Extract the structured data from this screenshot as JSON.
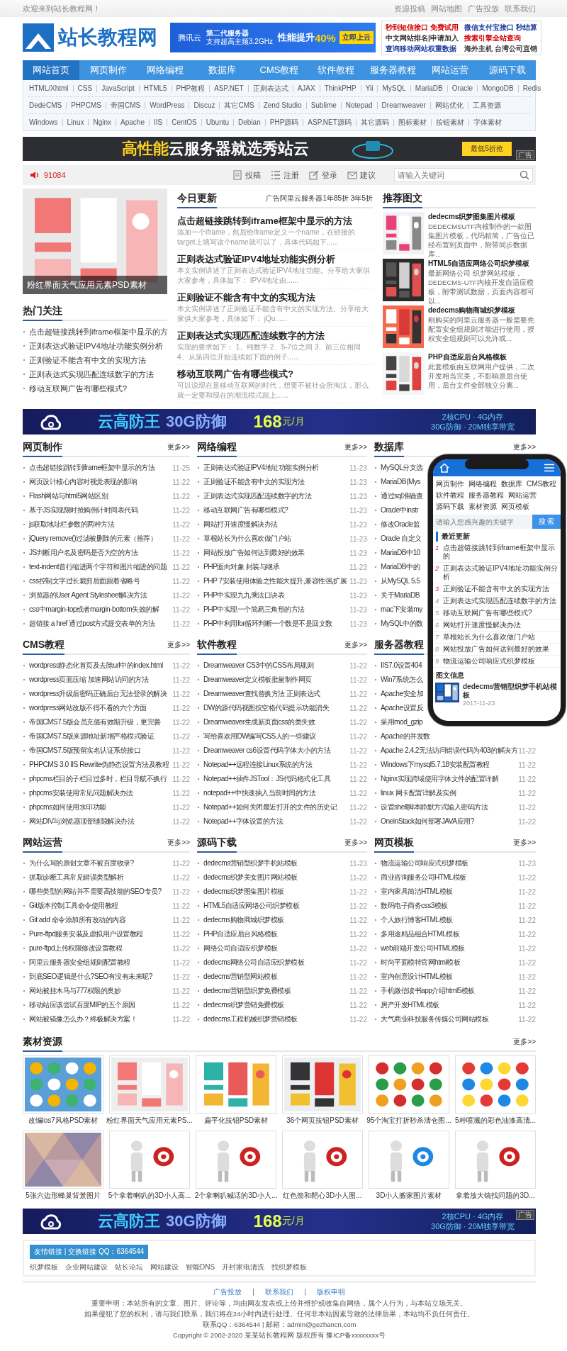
{
  "top_bar": {
    "welcome": "欢迎来到站长教程网！",
    "links": [
      "资源投稿",
      "网站地图",
      "广告投放",
      "联系我们"
    ]
  },
  "header": {
    "logo": "站长教程网",
    "banner": {
      "brand": "腾讯云",
      "line1": "第二代服务器",
      "line2": "支持超高主频3.2GHz",
      "headline": "性能提升",
      "highlight": "40%",
      "button": "立即上云"
    },
    "ad_links": [
      {
        "text": "秒到短信接口 免费试用",
        "color": "#d40000"
      },
      {
        "text": "微信支付宝接口 秒结算",
        "color": "#1a3a9c"
      },
      {
        "text": "中文网站排名|申请加入",
        "color": "#333333"
      },
      {
        "text": "搜索引擎全站查询",
        "color": "#d40000"
      },
      {
        "text": "查询移动网站权重数据",
        "color": "#1a3a9c"
      },
      {
        "text": "海外主机 台湾公司直销",
        "color": "#333333"
      }
    ]
  },
  "nav": [
    {
      "label": "网站首页",
      "selected": true
    },
    {
      "label": "网页制作",
      "selected": false
    },
    {
      "label": "网络编程",
      "selected": false
    },
    {
      "label": "数据库",
      "selected": false
    },
    {
      "label": "CMS教程",
      "selected": false
    },
    {
      "label": "软件教程",
      "selected": false
    },
    {
      "label": "服务器教程",
      "selected": false
    },
    {
      "label": "网站运营",
      "selected": false
    },
    {
      "label": "源码下载",
      "selected": false
    }
  ],
  "subnav": [
    [
      "HTML/Xhtml",
      "CSS",
      "JavaScript",
      "HTML5",
      "PHP教程",
      "ASP.NET",
      "正则表达式",
      "AJAX",
      "ThinkPHP",
      "Yii",
      "MySQL",
      "MariaDB",
      "Oracle",
      "MongoDB",
      "Redis"
    ],
    [
      "DedeCMS",
      "PHPCMS",
      "帝国CMS",
      "WordPress",
      "Discuz",
      "其它CMS",
      "Zend Studio",
      "Sublime",
      "Notepad",
      "Dreamweaver",
      "网站优化",
      "工具资源"
    ],
    [
      "Windows",
      "Linux",
      "Nginx",
      "Apache",
      "IIS",
      "CentOS",
      "Ubuntu",
      "Debian",
      "PHP源码",
      "ASP.NET源码",
      "其它源码",
      "图标素材",
      "按钮素材",
      "字体素材"
    ]
  ],
  "banner_ad": {
    "highlight": "高性能",
    "text": "云服务器就选秀站云",
    "button": "最低5折抢",
    "tag": "广告"
  },
  "toolbar": {
    "count": "91084",
    "actions": [
      "投稿",
      "注册",
      "登录",
      "建议"
    ],
    "search": {
      "placeholder": "请输入关键词"
    }
  },
  "featured": {
    "kind": "picture",
    "caption": "粉红界面天气应用元素PSD素材"
  },
  "hot": {
    "title": "热门关注",
    "items": [
      "点击超链接跳转到iframe框架中显示的方",
      "正则表达式验证IPV4地址功能实例分析",
      "正则验证不能含有中文的实现方法",
      "正则表达式实现匹配连续数字的方法",
      "移动互联网广告有哪些模式?"
    ]
  },
  "today": {
    "title": "今日更新",
    "ad": "广告阿里云服务器1年85折 3年5折",
    "articles": [
      {
        "title": "点击超链接跳转到iframe框架中显示的方法",
        "summary": "添加一个iframe，然后给iframe定义一个name，在链接的target上填写这个name就可以了，具体代码如下......"
      },
      {
        "title": "正则表达式验证IPV4地址功能实例分析",
        "summary": "本文实例讲述了正则表达式验证IPV4地址功能。分享给大家供大家参考，具体如下： IPV4地址由......"
      },
      {
        "title": "正则验证不能含有中文的实现方法",
        "summary": "本文实例讲述了正则验证不能含有中文的实现方法。分享给大家供大家参考，具体如下： jQu......"
      },
      {
        "title": "正则表达式实现匹配连续数字的方法",
        "summary": "实现的要求如下： 1、纯数字 2、5-7位之间 3、前三位相同 4、从第四位开始连续如下面的例子......"
      },
      {
        "title": "移动互联网广告有哪些模式?",
        "summary": "可以说现在是移动互联网的时代，想要不被社会所淘汰，那么就一定要和现在的潮流模式跟上......"
      }
    ]
  },
  "recommend": {
    "title": "推荐图文",
    "items": [
      {
        "title": "dedecms织梦图集图片模板",
        "desc": "DEDECMSUTF内核制作的一款图集图片模板，代码精简，广告位已经布置到页面中，附带同步数据库..."
      },
      {
        "title": "HTML5自适应网络公司织梦模板",
        "desc": "最新网络公司 织梦网站模板，DEDECMS-UTF内核开发自适应模板，附带测试数据，页面内容都可以..."
      },
      {
        "title": "dedecms购物商城织梦模板",
        "desc": "刚购买的阿里云服务器一般需要先配置安全组规则才能进行使用，授权安全组规则可以允许或..."
      },
      {
        "title": "PHP自适应后台风格模板",
        "desc": "此套模板由互联网用户提供，二次开发相当完美，不影响原后台使用，后台文件全部独立分离..."
      }
    ]
  },
  "ad_banner_top": {
    "title": "云高防王",
    "highlight": "30G防御",
    "price": "168",
    "unit": "元/月",
    "spec1": "2核CPU · 4G内存",
    "spec2": "30G防御 · 20M独享带宽"
  },
  "sections": [
    {
      "title": "网页制作",
      "more": "更多>>",
      "items": [
        {
          "title": "点击超链接跳转到iframe框架中显示的方法",
          "date": "11-25"
        },
        {
          "title": "网页设计核心内容对视觉表现的影响",
          "date": "11-22"
        },
        {
          "title": "Flash网站与html5网站区别",
          "date": "11-22"
        },
        {
          "title": "基于JS实现限时抢购倒计时间表代码",
          "date": "11-22"
        },
        {
          "title": "js获取地址栏参数的两种方法",
          "date": "11-22"
        },
        {
          "title": "jQuery remove()过滤被删除的元素（推荐）",
          "date": "11-22"
        },
        {
          "title": "JS判断用户名及密码是否为空的方法",
          "date": "11-22"
        },
        {
          "title": "text-indent首行缩进两个字符和图片缩进的问题",
          "date": "11-22"
        },
        {
          "title": "css控制文字过长裁剪后面跟着省略号",
          "date": "11-22"
        },
        {
          "title": "浏览器的User Agent Stylesheet解决方法",
          "date": "11-22"
        },
        {
          "title": "css中margin-top或者margin-bottom失效的解",
          "date": "11-22"
        },
        {
          "title": "超链接 a href 通过post方式提交表单的方法",
          "date": "11-22"
        }
      ]
    },
    {
      "title": "网络编程",
      "more": "更多>>",
      "items": [
        {
          "title": "正则表达式验证IPV4地址功能实例分析",
          "date": "11-23"
        },
        {
          "title": "正则验证不能含有中文的实现方法",
          "date": "11-23"
        },
        {
          "title": "正则表达式实现匹配连续数字的方法",
          "date": "11-23"
        },
        {
          "title": "移动互联网广告有哪些模式?",
          "date": "11-23"
        },
        {
          "title": "网站打开速度慢解决办法",
          "date": "11-23"
        },
        {
          "title": "草根站长为什么喜欢做门户站",
          "date": "11-23"
        },
        {
          "title": "网站投放广告如何达到最好的效果",
          "date": "11-23"
        },
        {
          "title": "PHP面向对象 封装与继承",
          "date": "11-23"
        },
        {
          "title": "PHP 7安装使用体验之性能大提升,兼容性强,扩展",
          "date": "11-23"
        },
        {
          "title": "PHP中实现九九乘法口诀表",
          "date": "11-23"
        },
        {
          "title": "PHP中实现一个简易三角形的方法",
          "date": "11-23"
        },
        {
          "title": "PHP中利用for循环判断一个数是不是回文数",
          "date": "11-23"
        }
      ]
    },
    {
      "title": "数据库",
      "more": "更多>>",
      "items": [
        {
          "title": "MySQL分支选"
        },
        {
          "title": "MariaDB(Mys"
        },
        {
          "title": "通过sql准确查"
        },
        {
          "title": "Oracle中instr"
        },
        {
          "title": "修改Oracle监"
        },
        {
          "title": "Oracle 自定义"
        },
        {
          "title": "MariaDB中10"
        },
        {
          "title": "MariaDB中的"
        },
        {
          "title": "从MySQL 5.5"
        },
        {
          "title": "关于MariaDB"
        },
        {
          "title": "mac下安装my"
        },
        {
          "title": "MySQL中的数"
        }
      ]
    },
    {
      "title": "CMS教程",
      "more": "更多>>",
      "items": [
        {
          "title": "wordpress静态化首页及去除url中的index.html",
          "date": "11-22"
        },
        {
          "title": "wordpress页面压缩 加速网站访问的方法",
          "date": "11-22"
        },
        {
          "title": "wordpress升级后密码正确后台无法登录的解决",
          "date": "11-22"
        },
        {
          "title": "wordpress网站改版不得不看的六个方面",
          "date": "11-22"
        },
        {
          "title": "帝国CMS7.5版会员充值有效期升级，更完善",
          "date": "11-22"
        },
        {
          "title": "帝国CMS7.5版来源地址新增严格模式验证",
          "date": "11-22"
        },
        {
          "title": "帝国CMS7.5版预留实名认证系统接口",
          "date": "11-22"
        },
        {
          "title": "PHPCMS 3.0 IIS Rewrite伪静态设置方法及教程",
          "date": "11-22"
        },
        {
          "title": "phpcms栏目的子栏目过多时，栏目导航不换行",
          "date": "11-22"
        },
        {
          "title": "phpcms安装使用常见问题解决办法",
          "date": "11-22"
        },
        {
          "title": "phpcms如何使用水印功能",
          "date": "11-22"
        },
        {
          "title": "网站DIV与浏览器顶部缝隙解决办法",
          "date": "11-22"
        }
      ]
    },
    {
      "title": "软件教程",
      "more": "更多>>",
      "items": [
        {
          "title": "Dreamweaver CS3中的CSS布局规则",
          "date": "11-22"
        },
        {
          "title": "Dreamweaver定义模板批量制作网页",
          "date": "11-22"
        },
        {
          "title": "Dreamweaver查找替换方法 正则表达式",
          "date": "11-22"
        },
        {
          "title": "DW的源代码视图按空格代码提示功能消失",
          "date": "11-22"
        },
        {
          "title": "Dreamweaver生成新页面css的类失效",
          "date": "11-22"
        },
        {
          "title": "写给喜欢用DW编写CSS人的一些建议",
          "date": "11-22"
        },
        {
          "title": "Dreamweaver cs6设置代码字体大小的方法",
          "date": "11-22"
        },
        {
          "title": "Notepad++远程连接Linux系统的方法",
          "date": "11-22"
        },
        {
          "title": "Notepad++插件JSTool：JS代码格式化工具",
          "date": "11-22"
        },
        {
          "title": "notepad++中快速插入当前时间的方法",
          "date": "11-22"
        },
        {
          "title": "Notepad++如何关闭最近打开的文件的历史记",
          "date": "11-22"
        },
        {
          "title": "Notepad++字体设置的方法",
          "date": "11-22"
        }
      ]
    },
    {
      "title": "服务器教程",
      "items": [
        {
          "title": "IIS7.0设置404"
        },
        {
          "title": "Win7系统怎么"
        },
        {
          "title": "Apache安全加"
        },
        {
          "title": "Apache设置反"
        },
        {
          "title": "采用mod_gzip"
        },
        {
          "title": "Apache的并发数"
        },
        {
          "title": "Apache 2.4.2无法访问错误代码为403的解决方",
          "date": "11-22"
        },
        {
          "title": "Windows下mysql5.7.18安装配置教程",
          "date": "11-22"
        },
        {
          "title": "Nginx实现跨域使用字体文件的配置详解",
          "date": "11-22"
        },
        {
          "title": "linux 网卡配置详解及实例",
          "date": "11-22"
        },
        {
          "title": "设置shell脚本静默方式输入密码方法",
          "date": "11-22"
        },
        {
          "title": "OneinStack如何部署JAVA应用?",
          "date": "11-22"
        }
      ]
    },
    {
      "title": "网站运营",
      "more": "更多>>",
      "items": [
        {
          "title": "为什么写的原创文章不被百度收录?",
          "date": "11-22"
        },
        {
          "title": "抓取诊断工具常见错误类型解析",
          "date": "11-22"
        },
        {
          "title": "哪些类型的网站并不需要高技能的SEO专员?",
          "date": "11-22"
        },
        {
          "title": "Git版本控制工具命令使用教程",
          "date": "11-22"
        },
        {
          "title": "Git add 命令添加所有改动的内容",
          "date": "11-22"
        },
        {
          "title": "Pure-ftpd服务安装及虚拟用户设置教程",
          "date": "11-22"
        },
        {
          "title": "pure-ftpd上传权限修改设置教程",
          "date": "11-22"
        },
        {
          "title": "阿里云服务器安全组规则配置教程",
          "date": "11-22"
        },
        {
          "title": "到底SEO逻辑是什么?SEO有没有未来呢?",
          "date": "11-22"
        },
        {
          "title": "网站被挂木马与777权限的奥妙",
          "date": "11-22"
        },
        {
          "title": "移动站应该尝试百度MIP的五个原因",
          "date": "11-22"
        },
        {
          "title": "网站被镜像怎么办？终极解决方案！",
          "date": "11-22"
        }
      ]
    },
    {
      "title": "源码下载",
      "more": "更多>>",
      "items": [
        {
          "title": "dedecms营销型织梦手机站模板",
          "date": "11-23"
        },
        {
          "title": "dedecms织梦美女图片网站模板",
          "date": "11-22"
        },
        {
          "title": "dedecms织梦图集图片模板",
          "date": "11-22"
        },
        {
          "title": "HTML5自适应网络公司织梦模板",
          "date": "11-22"
        },
        {
          "title": "dedecms购物商城织梦模板",
          "date": "11-22"
        },
        {
          "title": "PHP自适应后台风格模板",
          "date": "11-22"
        },
        {
          "title": "网络公司自适应织梦模板",
          "date": "11-22"
        },
        {
          "title": "dedecms网络公司自适应织梦模板",
          "date": "11-22"
        },
        {
          "title": "dedecms营销型网站模板",
          "date": "11-22"
        },
        {
          "title": "dedecms营销型织梦免费模板",
          "date": "11-22"
        },
        {
          "title": "dedecms织梦营销免费模板",
          "date": "11-22"
        },
        {
          "title": "dedecms工程机械织梦营销模板",
          "date": "11-22"
        }
      ]
    },
    {
      "title": "网页模板",
      "more": "更多>>",
      "items": [
        {
          "title": "物流运输公司响应式织梦模板",
          "date": "11-23"
        },
        {
          "title": "商业咨询服务公司HTML模板",
          "date": "11-22"
        },
        {
          "title": "室内家具简洁HTML模板",
          "date": "11-22"
        },
        {
          "title": "数码电子商务css3模板",
          "date": "11-22"
        },
        {
          "title": "个人旅行博客HTML模板",
          "date": "11-22"
        },
        {
          "title": "多用途精品组合HTML模板",
          "date": "11-22"
        },
        {
          "title": "web前端开发公司HTML模板",
          "date": "11-22"
        },
        {
          "title": "时尚平面模特官网html模板",
          "date": "11-22"
        },
        {
          "title": "室内创意设计HTML模板",
          "date": "11-22"
        },
        {
          "title": "手机微信读书app介绍html5模板",
          "date": "11-22"
        },
        {
          "title": "房产开发HTML模板",
          "date": "11-22"
        },
        {
          "title": "大气商业科技服务传媒公司网站模板",
          "date": "11-22"
        }
      ]
    }
  ],
  "materials": {
    "title": "素材资源",
    "more": "更多>>",
    "items": [
      {
        "caption": "改编ios7风格PSD素材"
      },
      {
        "caption": "粉红界面天气应用元素PS..."
      },
      {
        "caption": "扁平化按钮PSD素材"
      },
      {
        "caption": "36个网页按钮PSD素材"
      },
      {
        "caption": "95个淘宝打折秒杀清仓图..."
      },
      {
        "caption": "5种喷溅的彩色油漆高清..."
      },
      {
        "caption": "5张六边形蜂巢背景图片"
      },
      {
        "caption": "5个拿着喇叭的3D小人高..."
      },
      {
        "caption": "2个拿喇叭喊话的3D小人..."
      },
      {
        "caption": "红色箭和靶心3D小人图..."
      },
      {
        "caption": "3D小人搬家图片素材"
      },
      {
        "caption": "拿着放大镜找问题的3D..."
      }
    ]
  },
  "ad_banner_bottom": {
    "title": "云高防王",
    "highlight": "30G防御",
    "price": "168",
    "unit": "元/月",
    "spec1": "2核CPU · 4G内存",
    "spec2": "30G防御 · 20M独享带宽",
    "tag": "广告"
  },
  "friend_links": {
    "label": "友情链接 | 交换链接 QQ：6364544",
    "links": [
      "织梦模板",
      "企业网站建设",
      "站长论坛",
      "网站建设",
      "智能DNS",
      "开封家电清洗",
      "找织梦模板"
    ]
  },
  "footer": {
    "links": [
      "广告投放",
      "联系我们",
      "版权申明"
    ],
    "lines": [
      "重要申明：本站所有的文章、图片、评论等，均由网友发表或上传并维护或收集自网络，属个人行为，与本站立场无关。",
      "如果侵犯了您的权利，请与我们联系，我们将在24小时内进行处理、任何非本站因素导致的法律后果，本站均不负任何责任。",
      "联系QQ：6364544 | 邮箱：admin@gezhancn.com",
      "Copyright © 2002-2020 某某站长教程网 版权所有 豫ICP备xxxxxxxx号"
    ]
  },
  "phone": {
    "nav": [
      "网页制作",
      "网络编程",
      "数据库",
      "CMS教程",
      "软件教程",
      "服务器教程",
      "网站运营",
      "源码下载",
      "素材资源",
      "网页模板"
    ],
    "search": {
      "placeholder": "请输入您感兴趣的关键字",
      "button": "搜 索"
    },
    "recent_title": "最近更新",
    "recent": [
      {
        "num": "1",
        "title": "点击超链接跳转到iframe框架中显示的"
      },
      {
        "num": "2",
        "title": "正则表达式验证IPV4地址功能实例分析"
      },
      {
        "num": "3",
        "title": "正则验证不能含有中文的实现方法"
      },
      {
        "num": "4",
        "title": "正则表达式实现匹配连续数字的方法"
      },
      {
        "num": "5",
        "title": "移动互联网广告有哪些模式?"
      },
      {
        "num": "6",
        "title": "网站打开速度慢解决办法"
      },
      {
        "num": "7",
        "title": "草根站长为什么喜欢做门户站"
      },
      {
        "num": "8",
        "title": "网站投放广告如何达到最好的效果"
      },
      {
        "num": "9",
        "title": "物流运输公司响应式织梦模板"
      }
    ],
    "pics_title": "图文信息",
    "pic_item": {
      "title": "dedecms营销型织梦手机站模板",
      "date": "2017-11-23"
    }
  }
}
